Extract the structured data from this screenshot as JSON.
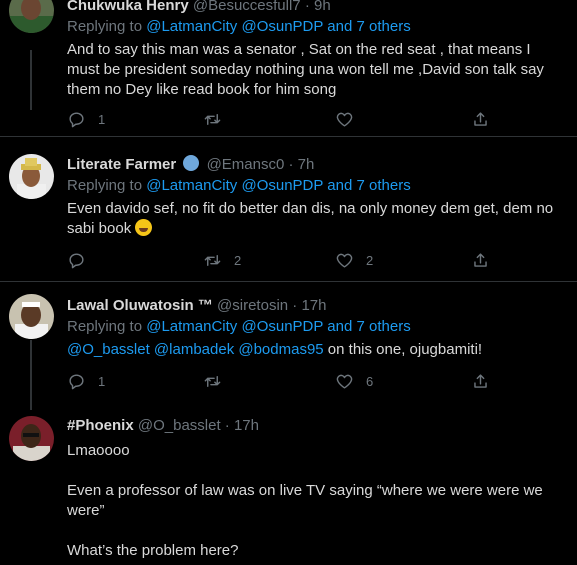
{
  "tweets": [
    {
      "name": "Chukwuka Henry",
      "handle": "@Besuccesfull7",
      "time": "9h",
      "replying_prefix": "Replying to ",
      "replying_links": "@LatmanCity @OsunPDP and 7 others",
      "text": "And to say this man was a senator , Sat on the red seat , that means I must be president someday nothing una won tell me ,David son talk say them no Dey like read book for him song",
      "reply_count": "1",
      "retweet_count": "",
      "like_count": ""
    },
    {
      "name": "Literate Farmer",
      "handle": "@Emansc0",
      "time": "7h",
      "replying_prefix": "Replying to ",
      "replying_links": "@LatmanCity @OsunPDP and 7 others",
      "text": "Even davido sef, no fit do better dan dis, na only money dem get, dem no sabi book",
      "reply_count": "",
      "retweet_count": "2",
      "like_count": "2"
    },
    {
      "name": "Lawal Oluwatosin ™",
      "handle": "@siretosin",
      "time": "17h",
      "replying_prefix": "Replying to ",
      "replying_links": "@LatmanCity @OsunPDP and 7 others",
      "mentions": "@O_basslet @lambadek @bodmas95",
      "text_after": " on this one, ojugbamiti!",
      "reply_count": "1",
      "retweet_count": "",
      "like_count": "6"
    },
    {
      "name": "#Phoenix",
      "handle": "@O_basslet",
      "time": "17h",
      "text_lines": [
        "Lmaoooo",
        "Even a professor of law was on live TV saying “where we were were we were”",
        "What’s the problem here?"
      ]
    }
  ],
  "separator": "·",
  "colors": {
    "background": "#000000",
    "link": "#1d9bf0",
    "muted": "#6e767d",
    "text": "#d9d9d9",
    "verified": "#6fa8dc"
  },
  "icons": [
    "reply-icon",
    "retweet-icon",
    "like-icon",
    "share-icon",
    "verified-badge-icon",
    "rolling-laughing-emoji"
  ]
}
